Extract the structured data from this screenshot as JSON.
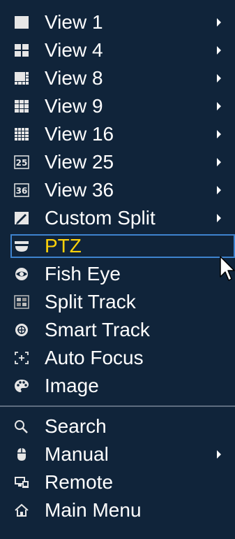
{
  "menu": {
    "items": [
      {
        "label": "View 1",
        "icon": "view-1-icon",
        "submenu": true
      },
      {
        "label": "View 4",
        "icon": "view-4-icon",
        "submenu": true
      },
      {
        "label": "View 8",
        "icon": "view-8-icon",
        "submenu": true
      },
      {
        "label": "View 9",
        "icon": "view-9-icon",
        "submenu": true
      },
      {
        "label": "View 16",
        "icon": "view-16-icon",
        "submenu": true
      },
      {
        "label": "View 25",
        "icon": "view-25-icon",
        "icon_text": "25",
        "submenu": true
      },
      {
        "label": "View 36",
        "icon": "view-36-icon",
        "icon_text": "36",
        "submenu": true
      },
      {
        "label": "Custom Split",
        "icon": "custom-split-icon",
        "submenu": true
      },
      {
        "label": "PTZ",
        "icon": "ptz-icon",
        "submenu": false,
        "selected": true
      },
      {
        "label": "Fish Eye",
        "icon": "fish-eye-icon",
        "submenu": false
      },
      {
        "label": "Split Track",
        "icon": "split-track-icon",
        "submenu": false
      },
      {
        "label": "Smart Track",
        "icon": "smart-track-icon",
        "submenu": false
      },
      {
        "label": "Auto Focus",
        "icon": "auto-focus-icon",
        "submenu": false
      },
      {
        "label": "Image",
        "icon": "image-icon",
        "submenu": false
      },
      {
        "label": "Search",
        "icon": "search-icon",
        "submenu": false
      },
      {
        "label": "Manual",
        "icon": "manual-icon",
        "submenu": true
      },
      {
        "label": "Remote",
        "icon": "remote-icon",
        "submenu": false
      },
      {
        "label": "Main Menu",
        "icon": "main-menu-icon",
        "submenu": false
      }
    ]
  },
  "colors": {
    "background": "#10243a",
    "text": "#ffffff",
    "selected_text": "#ffd20a",
    "selected_border": "#3e83ce",
    "divider": "#5e6d80"
  }
}
